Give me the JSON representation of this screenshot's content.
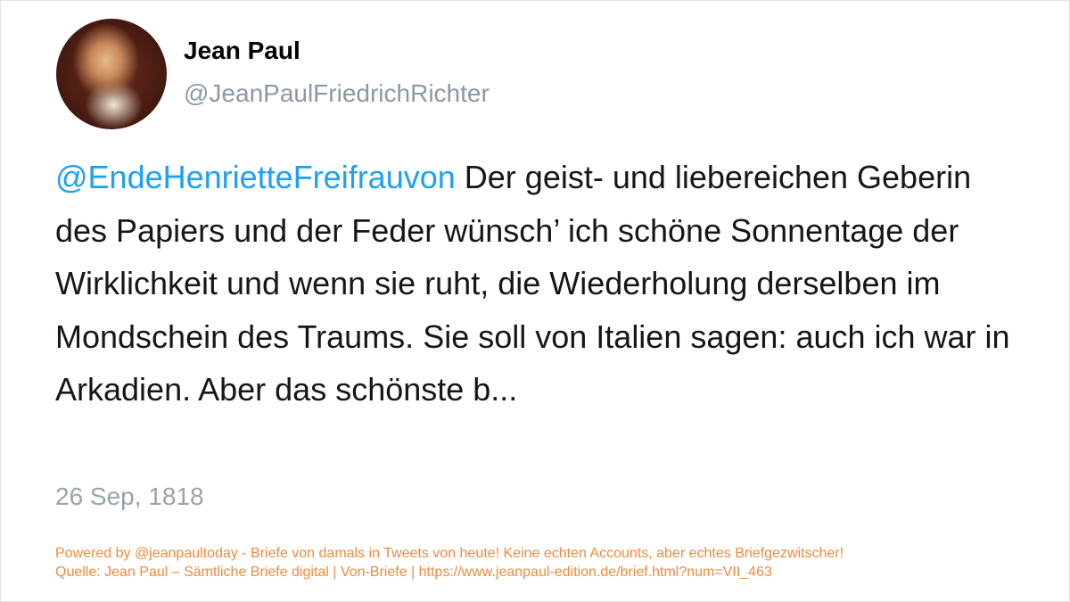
{
  "author": {
    "name": "Jean Paul",
    "handle": "@JeanPaulFriedrichRichter",
    "avatar_icon": "portrait-avatar"
  },
  "tweet": {
    "mention": "@EndeHenrietteFreifrauvon",
    "text": " Der geist- und liebereichen Geberin des Papiers und der Feder wünsch’ ich schöne Sonnentage der Wirklichkeit und wenn sie ruht, die Wiederholung derselben im Mondschein des Traums. Sie soll von Italien sagen: auch ich war in Arkadien. Aber das schönste b...",
    "date": "26 Sep, 1818"
  },
  "footer": {
    "line1": "Powered by @jeanpaultoday - Briefe von damals in Tweets von heute! Keine echten Accounts, aber echtes Briefgezwitscher!",
    "line2": "Quelle: Jean Paul – Sämtliche Briefe digital | Von-Briefe | https://www.jeanpaul-edition.de/brief.html?num=VII_463"
  },
  "colors": {
    "mention": "#1da1f2",
    "footer": "#f08a3c",
    "muted": "#99a3ad"
  }
}
